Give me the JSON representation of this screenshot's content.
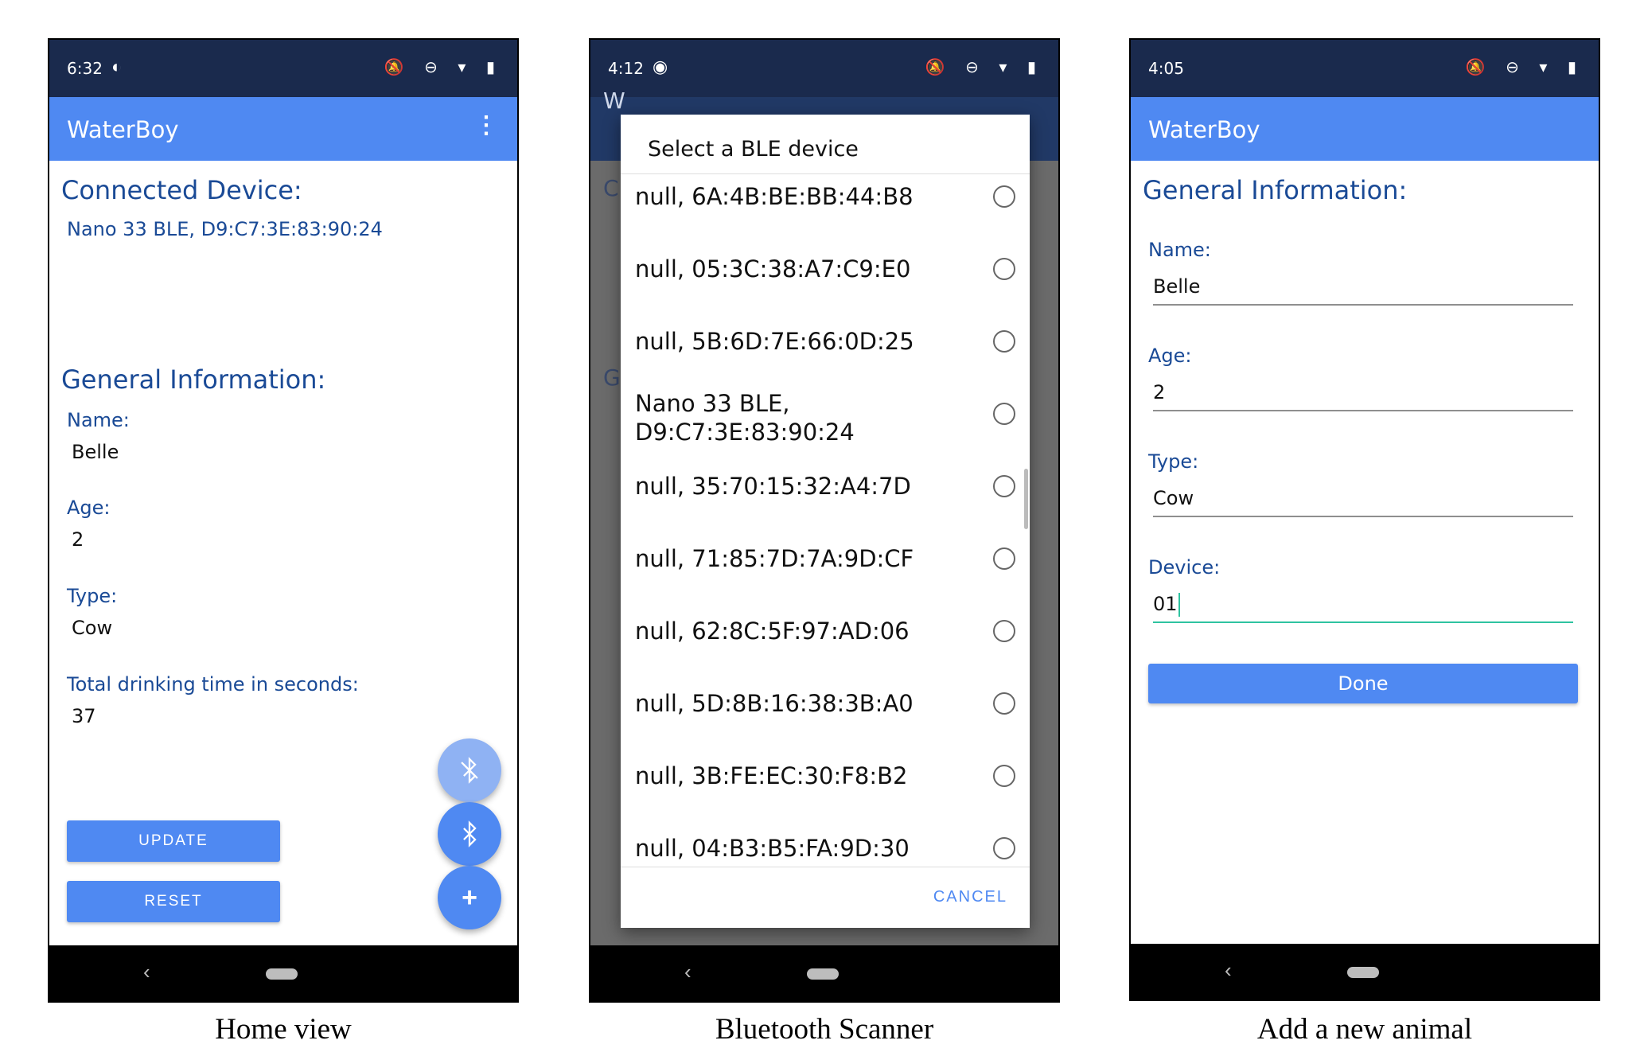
{
  "home": {
    "status_time": "6:32",
    "status_icons": "🔕 ⊖ ▾ ▮",
    "app_title": "WaterBoy",
    "menu_icon": "⋮",
    "connected_heading": "Connected Device:",
    "connected_value": "Nano 33 BLE, D9:C7:3E:83:90:24",
    "general_heading": "General Information:",
    "name_label": "Name:",
    "name_value": "Belle",
    "age_label": "Age:",
    "age_value": "2",
    "type_label": "Type:",
    "type_value": "Cow",
    "drink_label": "Total drinking time in seconds:",
    "drink_value": "37",
    "update_button": "UPDATE",
    "reset_button": "RESET",
    "fab_bluetooth_disabled_icon": "bluetooth-disabled-icon",
    "fab_bluetooth_icon": "bluetooth-icon",
    "fab_add": "+",
    "caption": "Home view"
  },
  "scanner": {
    "status_time": "4:12",
    "status_icons": "🔕 ⊖ ▾ ▮",
    "dialog_title": "Select a BLE device",
    "devices": [
      "null, 6A:4B:BE:BB:44:B8",
      "null, 05:3C:38:A7:C9:E0",
      "null, 5B:6D:7E:66:0D:25",
      "Nano 33 BLE,\nD9:C7:3E:83:90:24",
      "null, 35:70:15:32:A4:7D",
      "null, 71:85:7D:7A:9D:CF",
      "null, 62:8C:5F:97:AD:06",
      "null, 5D:8B:16:38:3B:A0",
      "null, 3B:FE:EC:30:F8:B2",
      "null, 04:B3:B5:FA:9D:30"
    ],
    "cancel_button": "CANCEL",
    "caption": "Bluetooth Scanner"
  },
  "add": {
    "status_time": "4:05",
    "status_icons": "🔕 ⊖ ▾ ▮",
    "app_title": "WaterBoy",
    "general_heading": "General Information:",
    "name_label": "Name:",
    "name_value": "Belle",
    "age_label": "Age:",
    "age_value": "2",
    "type_label": "Type:",
    "type_value": "Cow",
    "device_label": "Device:",
    "device_value": "01",
    "done_button": "Done",
    "caption": "Add a new animal"
  },
  "nav": {
    "back_icon": "‹"
  },
  "colors": {
    "appbar": "#4f89f2",
    "statusbar": "#1a2a4d",
    "heading": "#1a4a96",
    "accent_cursor": "#2fc3a0"
  }
}
